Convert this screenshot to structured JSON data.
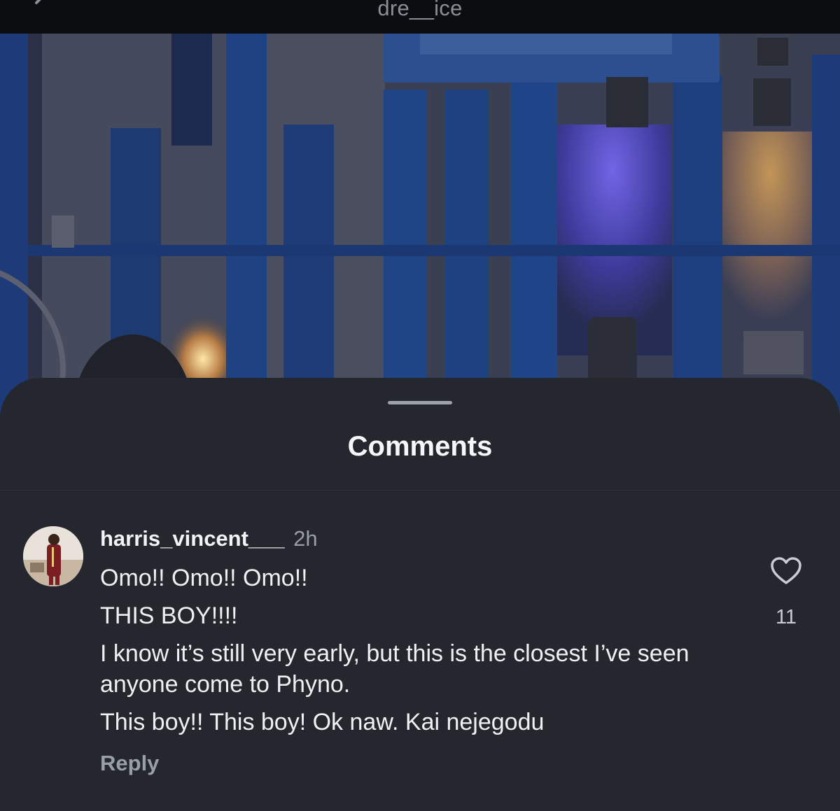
{
  "header": {
    "title": "dre__ice",
    "back_icon": "chevron-left-icon"
  },
  "sheet": {
    "title": "Comments"
  },
  "comment": {
    "username": "harris_vincent___",
    "time": "2h",
    "lines": [
      "Omo!! Omo!! Omo!!",
      "THIS BOY!!!!",
      "I know it’s still very early, but this is the closest I’ve seen anyone come to Phyno.",
      "This boy!! This boy!  Ok naw. Kai nejegodu"
    ],
    "like_icon": "heart-outline-icon",
    "like_count": "11",
    "reply_label": "Reply"
  },
  "colors": {
    "sheet_bg": "#24272d",
    "header_bg": "#0c0d10",
    "scene_blue": "#1d3f7e",
    "muted_text": "#9a9ea6"
  }
}
